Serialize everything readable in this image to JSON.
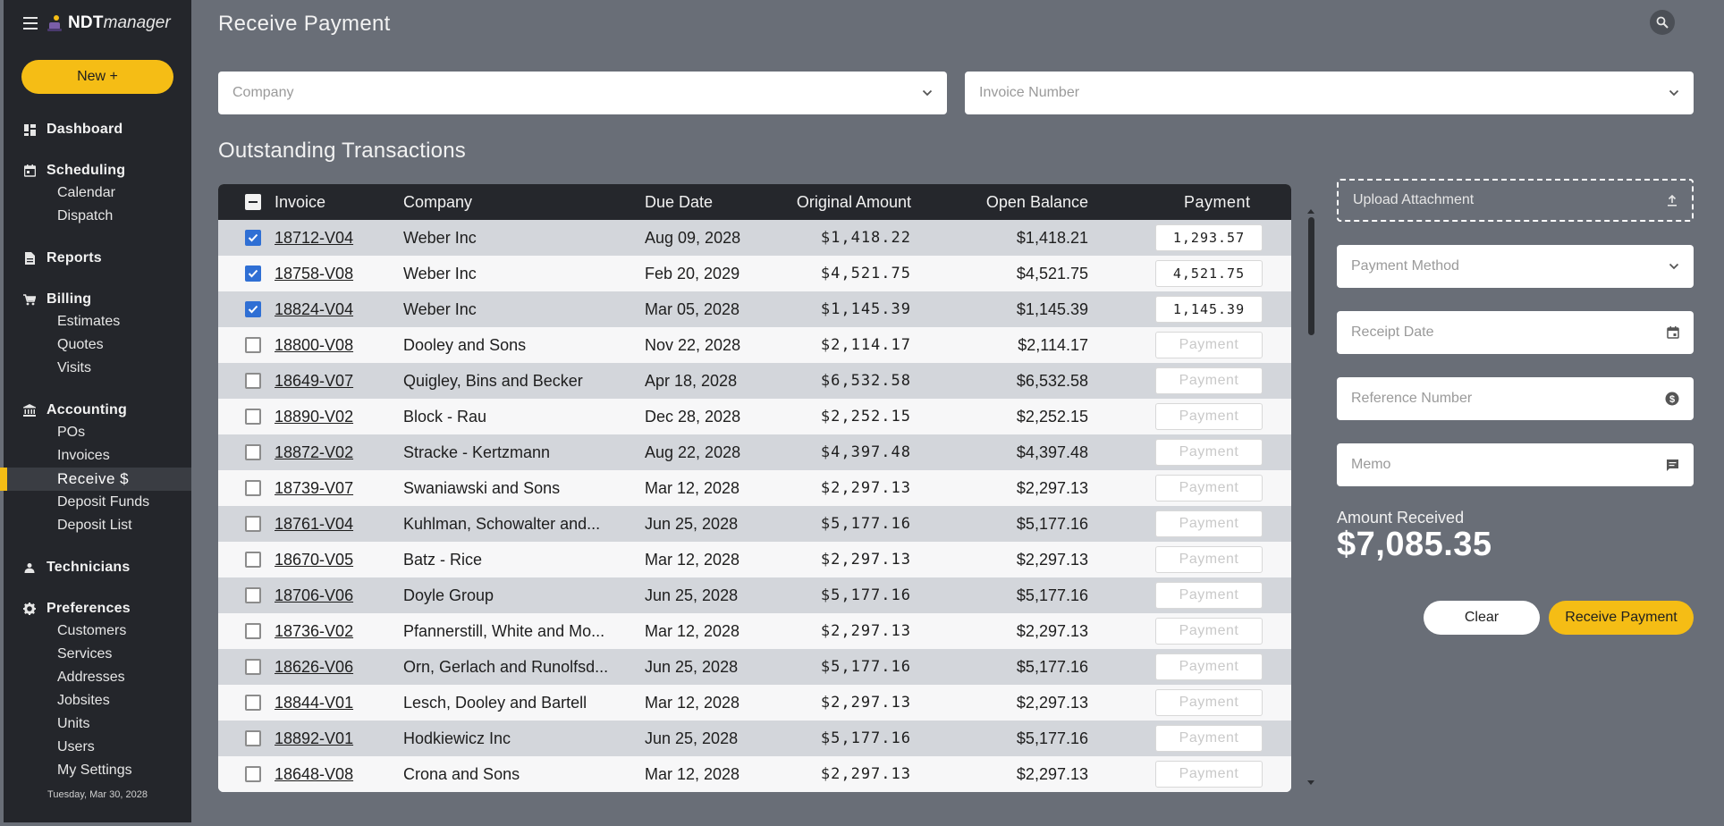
{
  "app": {
    "brand_bold": "NDT",
    "brand_italic": "manager",
    "new_button": "New +",
    "date": "Tuesday, Mar 30, 2028"
  },
  "nav": {
    "dashboard": "Dashboard",
    "scheduling": "Scheduling",
    "calendar": "Calendar",
    "dispatch": "Dispatch",
    "reports": "Reports",
    "billing": "Billing",
    "estimates": "Estimates",
    "quotes": "Quotes",
    "visits": "Visits",
    "accounting": "Accounting",
    "pos": "POs",
    "invoices": "Invoices",
    "receive": "Receive $",
    "deposit_funds": "Deposit Funds",
    "deposit_list": "Deposit List",
    "technicians": "Technicians",
    "preferences": "Preferences",
    "customers": "Customers",
    "services": "Services",
    "addresses": "Addresses",
    "jobsites": "Jobsites",
    "units": "Units",
    "users": "Users",
    "my_settings": "My Settings"
  },
  "page": {
    "title": "Receive Payment",
    "company_placeholder": "Company",
    "invoice_placeholder": "Invoice Number",
    "section_title": "Outstanding Transactions"
  },
  "table": {
    "headers": {
      "invoice": "Invoice",
      "company": "Company",
      "due": "Due Date",
      "original": "Original Amount",
      "open": "Open Balance",
      "payment": "Payment"
    },
    "payment_placeholder": "Payment",
    "rows": [
      {
        "checked": true,
        "invoice": "18712-V04",
        "company": "Weber Inc",
        "due": "Aug 09, 2028",
        "original": "$1,418.22",
        "open": "$1,418.21",
        "payment": "1,293.57"
      },
      {
        "checked": true,
        "invoice": "18758-V08",
        "company": "Weber Inc",
        "due": "Feb 20, 2029",
        "original": "$4,521.75",
        "open": "$4,521.75",
        "payment": "4,521.75"
      },
      {
        "checked": true,
        "invoice": "18824-V04",
        "company": "Weber Inc",
        "due": "Mar 05, 2028",
        "original": "$1,145.39",
        "open": "$1,145.39",
        "payment": "1,145.39"
      },
      {
        "checked": false,
        "invoice": "18800-V08",
        "company": "Dooley and Sons",
        "due": "Nov 22, 2028",
        "original": "$2,114.17",
        "open": "$2,114.17",
        "payment": ""
      },
      {
        "checked": false,
        "invoice": "18649-V07",
        "company": "Quigley, Bins and Becker",
        "due": "Apr 18, 2028",
        "original": "$6,532.58",
        "open": "$6,532.58",
        "payment": ""
      },
      {
        "checked": false,
        "invoice": "18890-V02",
        "company": "Block - Rau",
        "due": "Dec 28, 2028",
        "original": "$2,252.15",
        "open": "$2,252.15",
        "payment": ""
      },
      {
        "checked": false,
        "invoice": "18872-V02",
        "company": "Stracke - Kertzmann",
        "due": "Aug 22, 2028",
        "original": "$4,397.48",
        "open": "$4,397.48",
        "payment": ""
      },
      {
        "checked": false,
        "invoice": "18739-V07",
        "company": "Swaniawski and Sons",
        "due": "Mar 12, 2028",
        "original": "$2,297.13",
        "open": "$2,297.13",
        "payment": ""
      },
      {
        "checked": false,
        "invoice": "18761-V04",
        "company": "Kuhlman, Schowalter and...",
        "due": "Jun 25, 2028",
        "original": "$5,177.16",
        "open": "$5,177.16",
        "payment": ""
      },
      {
        "checked": false,
        "invoice": "18670-V05",
        "company": "Batz - Rice",
        "due": "Mar 12, 2028",
        "original": "$2,297.13",
        "open": "$2,297.13",
        "payment": ""
      },
      {
        "checked": false,
        "invoice": "18706-V06",
        "company": "Doyle Group",
        "due": "Jun 25, 2028",
        "original": "$5,177.16",
        "open": "$5,177.16",
        "payment": ""
      },
      {
        "checked": false,
        "invoice": "18736-V02",
        "company": "Pfannerstill, White and Mo...",
        "due": "Mar 12, 2028",
        "original": "$2,297.13",
        "open": "$2,297.13",
        "payment": ""
      },
      {
        "checked": false,
        "invoice": "18626-V06",
        "company": "Orn, Gerlach and Runolfsd...",
        "due": "Jun 25, 2028",
        "original": "$5,177.16",
        "open": "$5,177.16",
        "payment": ""
      },
      {
        "checked": false,
        "invoice": "18844-V01",
        "company": "Lesch, Dooley and Bartell",
        "due": "Mar 12, 2028",
        "original": "$2,297.13",
        "open": "$2,297.13",
        "payment": ""
      },
      {
        "checked": false,
        "invoice": "18892-V01",
        "company": "Hodkiewicz Inc",
        "due": "Jun 25, 2028",
        "original": "$5,177.16",
        "open": "$5,177.16",
        "payment": ""
      },
      {
        "checked": false,
        "invoice": "18648-V08",
        "company": "Crona and Sons",
        "due": "Mar 12, 2028",
        "original": "$2,297.13",
        "open": "$2,297.13",
        "payment": ""
      }
    ]
  },
  "panel": {
    "upload": "Upload Attachment",
    "method": "Payment Method",
    "receipt_date": "Receipt Date",
    "reference": "Reference Number",
    "memo": "Memo",
    "amount_label": "Amount Received",
    "amount_value": "$7,085.35",
    "clear": "Clear",
    "receive": "Receive Payment"
  },
  "colors": {
    "accent": "#f5bd15",
    "sidebar": "#24262b",
    "background": "#696e77",
    "checkbox": "#2f6fd4"
  }
}
